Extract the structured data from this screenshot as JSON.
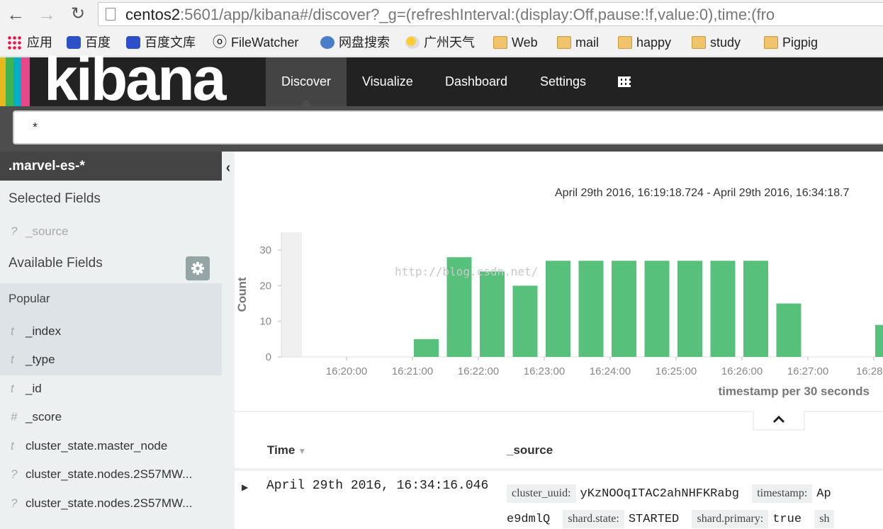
{
  "browser": {
    "url_host": "centos2",
    "url_rest": ":5601/app/kibana#/discover?_g=(refreshInterval:(display:Off,pause:!f,value:0),time:(fro",
    "bookmarks": [
      {
        "label": "应用",
        "icon": "apps-grid-icon"
      },
      {
        "label": "百度",
        "icon": "baidu-paw-icon"
      },
      {
        "label": "百度文库",
        "icon": "baidu-paw-icon"
      },
      {
        "label": "FileWatcher",
        "icon": "eyes-icon"
      },
      {
        "label": "网盘搜索",
        "icon": "search-icon"
      },
      {
        "label": "广州天气",
        "icon": "weather-icon"
      },
      {
        "label": "Web",
        "icon": "folder-icon"
      },
      {
        "label": "mail",
        "icon": "folder-icon"
      },
      {
        "label": "happy",
        "icon": "folder-icon"
      },
      {
        "label": "study",
        "icon": "folder-icon"
      },
      {
        "label": "Pigpig",
        "icon": "folder-icon"
      }
    ]
  },
  "kibana": {
    "logo": "kibana",
    "logo_colors": [
      "#e8b71c",
      "#3fb34f",
      "#00aec7",
      "#e8478b"
    ],
    "tabs": [
      {
        "label": "Discover",
        "active": true
      },
      {
        "label": "Visualize",
        "active": false
      },
      {
        "label": "Dashboard",
        "active": false
      },
      {
        "label": "Settings",
        "active": false
      }
    ]
  },
  "query": {
    "value": "*"
  },
  "sidebar": {
    "index_pattern": ".marvel-es-*",
    "selected_heading": "Selected Fields",
    "selected_fields": [
      {
        "type": "?",
        "name": "_source"
      }
    ],
    "available_heading": "Available Fields",
    "popular_heading": "Popular",
    "popular_fields": [
      {
        "type": "t",
        "name": "_index"
      },
      {
        "type": "t",
        "name": "_type"
      }
    ],
    "fields": [
      {
        "type": "t",
        "name": "_id"
      },
      {
        "type": "#",
        "name": "_score"
      },
      {
        "type": "t",
        "name": "cluster_state.master_node"
      },
      {
        "type": "?",
        "name": "cluster_state.nodes.2S57MW..."
      },
      {
        "type": "?",
        "name": "cluster_state.nodes.2S57MW..."
      }
    ]
  },
  "main": {
    "time_range": "April 29th 2016, 16:19:18.724 - April 29th 2016, 16:34:18.7",
    "watermark": "http://blog.csdn.net/",
    "columns": {
      "time": "Time",
      "source": "_source"
    },
    "rows": [
      {
        "time": "April 29th 2016, 16:34:16.046",
        "line1": [
          {
            "key": "cluster_uuid:",
            "value": "yKzNOOqITAC2ahNHFKRabg"
          },
          {
            "key": "timestamp:",
            "value": "Ap"
          }
        ],
        "line2": [
          {
            "key": "",
            "value": "e9dmlQ"
          },
          {
            "key": "shard.state:",
            "value": "STARTED"
          },
          {
            "key": "shard.primary:",
            "value": "true"
          },
          {
            "key": "sh",
            "value": ""
          }
        ]
      }
    ]
  },
  "chart_data": {
    "type": "bar",
    "ylabel": "Count",
    "xlabel": "timestamp per 30 seconds",
    "ylim": [
      0,
      35
    ],
    "yticks": [
      0,
      10,
      20,
      30
    ],
    "xticks": [
      "16:20:00",
      "16:21:00",
      "16:22:00",
      "16:23:00",
      "16:24:00",
      "16:25:00",
      "16:26:00",
      "16:27:00",
      "16:28:0"
    ],
    "color": "#57c17b",
    "categories": [
      "16:21:00",
      "16:21:30",
      "16:22:00",
      "16:22:30",
      "16:23:00",
      "16:23:30",
      "16:24:00",
      "16:24:30",
      "16:25:00",
      "16:25:30",
      "16:26:00",
      "16:26:30",
      "16:28:00"
    ],
    "values": [
      5,
      28,
      24,
      20,
      27,
      27,
      27,
      27,
      27,
      27,
      27,
      15,
      9
    ]
  }
}
